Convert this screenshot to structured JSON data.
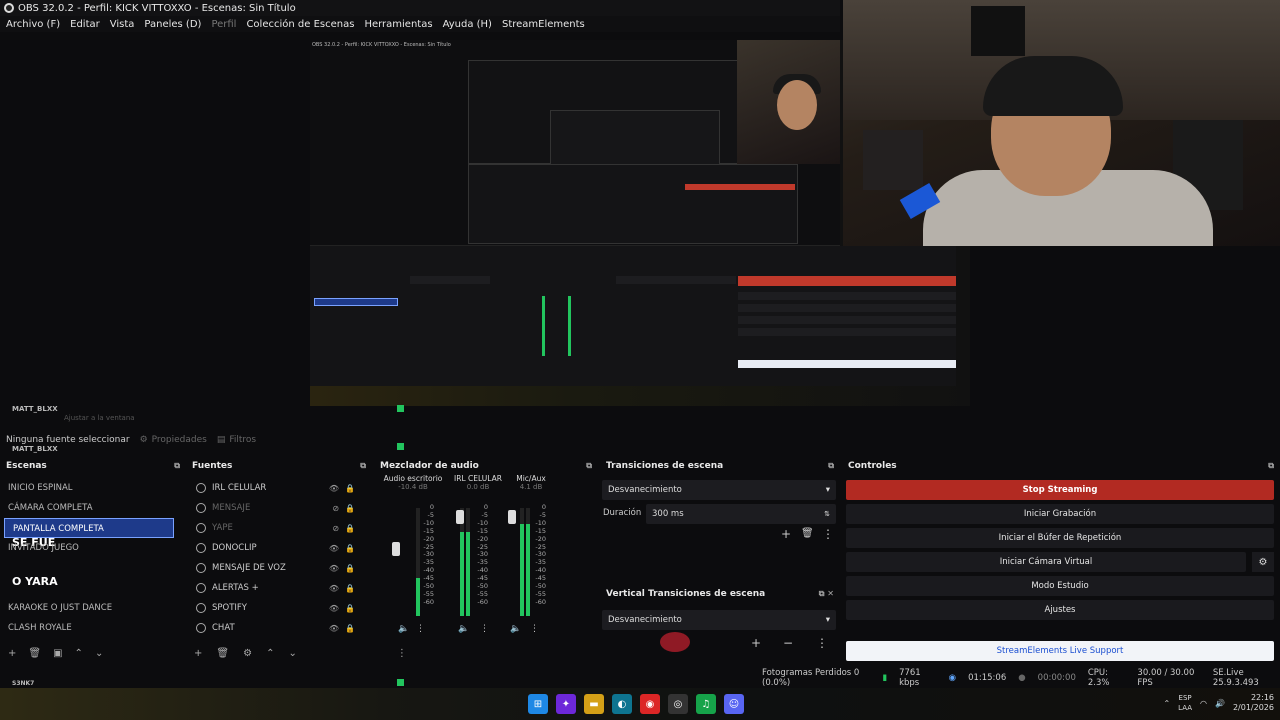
{
  "window": {
    "title": "OBS 32.0.2 - Perfil: KICK VITTOXXO - Escenas: Sin Título"
  },
  "menu": {
    "items": [
      "Archivo (F)",
      "Editar",
      "Vista",
      "Paneles (D)",
      "Perfil",
      "Colección de Escenas",
      "Herramientas",
      "Ayuda (H)",
      "StreamElements"
    ]
  },
  "ghost": {
    "matt_blxx": "MATT_BLXX",
    "ajustar": "Ajustar a la ventana",
    "se_fue": "SE FUE",
    "o_yara": "O YARA",
    "snk7": "S3NK7"
  },
  "source_toolbar": {
    "no_source": "Ninguna fuente seleccionar",
    "properties": "Propiedades",
    "filters": "Filtros"
  },
  "scenes": {
    "header": "Escenas",
    "items": [
      "INICIO ESPINAL",
      "CÁMARA COMPLETA",
      "PANTALLA COMPLETA",
      "INVITADO JUEGO",
      "",
      "",
      "KARAOKE O JUST DANCE",
      "CLASH ROYALE"
    ],
    "selected_index": 2
  },
  "sources": {
    "header": "Fuentes",
    "items": [
      {
        "label": "IRL CELULAR",
        "visible": true
      },
      {
        "label": "MENSAJE",
        "visible": false
      },
      {
        "label": "YAPE",
        "visible": false
      },
      {
        "label": "DONOCLIP",
        "visible": true
      },
      {
        "label": "MENSAJE DE VOZ",
        "visible": true
      },
      {
        "label": "ALERTAS +",
        "visible": true
      },
      {
        "label": "SPOTIFY",
        "visible": true
      },
      {
        "label": "CHAT",
        "visible": true
      }
    ]
  },
  "mixer": {
    "header": "Mezclador de audio",
    "channels": [
      {
        "name": "Audio escritorio",
        "db": "-10.4 dB",
        "level": 0.35
      },
      {
        "name": "IRL CELULAR",
        "db": "0.0 dB",
        "level": 0.78
      },
      {
        "name": "Mic/Aux",
        "db": "4.1 dB",
        "level": 0.85
      }
    ],
    "scale": [
      "0",
      "-5",
      "-10",
      "-15",
      "-20",
      "-25",
      "-30",
      "-35",
      "-40",
      "-45",
      "-50",
      "-55",
      "-60"
    ]
  },
  "transitions": {
    "header": "Transiciones de escena",
    "selected": "Desvanecimiento",
    "duration_label": "Duración",
    "duration_value": "300 ms"
  },
  "vertical_transitions": {
    "header": "Vertical Transiciones de escena",
    "selected": "Desvanecimiento"
  },
  "controls": {
    "header": "Controles",
    "stop_streaming": "Stop Streaming",
    "start_recording": "Iniciar Grabación",
    "replay_buffer": "Iniciar el Búfer de Repetición",
    "virtual_camera": "Iniciar Cámara Virtual",
    "studio_mode": "Modo Estudio",
    "settings": "Ajustes",
    "live_support": "StreamElements Live Support"
  },
  "status": {
    "dropped_frames": "Fotogramas Perdidos 0 (0.0%)",
    "bitrate": "7761 kbps",
    "stream_time": "01:15:06",
    "rec_time": "00:00:00",
    "cpu": "CPU: 2.3%",
    "fps": "30.00 / 30.00 FPS",
    "version": "SE.Live 25.9.3.493"
  },
  "taskbar": {
    "lang_top": "ESP",
    "lang_bottom": "LAA",
    "time": "22:16",
    "date": "2/01/2026"
  },
  "colors": {
    "stop_red": "#b22a22",
    "selected_blue": "#1e3a8a",
    "meter_green": "#22c55e",
    "support_link": "#1b4fd1"
  }
}
